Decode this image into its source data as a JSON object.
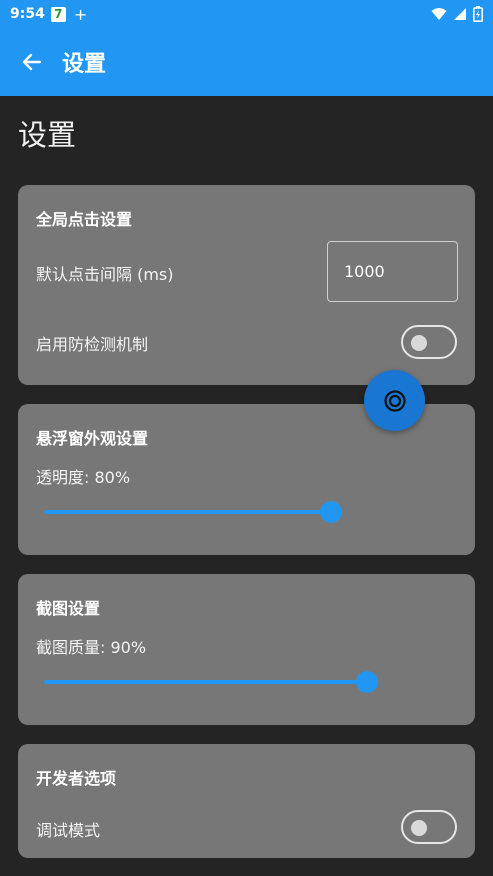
{
  "status_bar": {
    "time": "9:54",
    "badge": "7",
    "plus": "+",
    "icons": [
      "wifi-icon",
      "signal-icon",
      "battery-icon"
    ]
  },
  "app_bar": {
    "title": "设置",
    "back_icon": "arrow-back-icon"
  },
  "page": {
    "heading": "设置"
  },
  "sections": {
    "global": {
      "title": "全局点击设置",
      "interval_label": "默认点击间隔 (ms)",
      "interval_value": "1000",
      "anti_detect_label": "启用防检测机制",
      "anti_detect_on": false
    },
    "floating": {
      "title": "悬浮窗外观设置",
      "opacity_label": "透明度: 80%",
      "opacity_percent": 80
    },
    "screenshot": {
      "title": "截图设置",
      "quality_label": "截图质量: 90%",
      "quality_percent": 90
    },
    "developer": {
      "title": "开发者选项",
      "debug_label": "调试模式",
      "debug_on": false
    }
  },
  "fab": {
    "icon": "target-icon"
  },
  "colors": {
    "primary": "#2196F3",
    "fab": "#1976D2",
    "background": "#242424",
    "card": "#777777"
  }
}
